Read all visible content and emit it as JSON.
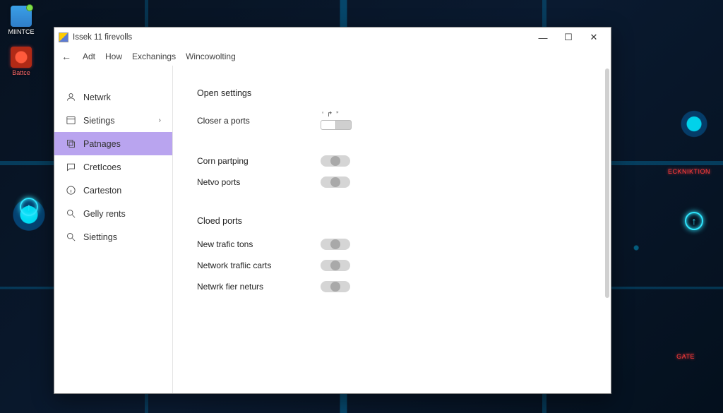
{
  "desktop": {
    "icon1_label": "MIINTCE",
    "icon2_label": "Battce"
  },
  "wallpaper_tags": {
    "tag1": "ECKNIKTION",
    "tag2": "GATE"
  },
  "window": {
    "title": "Issek 11 firevolls"
  },
  "menubar": {
    "item1": "Adt",
    "item2": "How",
    "item3": "Exchanings",
    "item4": "Wincowolting"
  },
  "sidebar": {
    "items": [
      {
        "label": "Netwrk"
      },
      {
        "label": "Sietings"
      },
      {
        "label": "Patnages"
      },
      {
        "label": "CretIcoes"
      },
      {
        "label": "Carteston"
      },
      {
        "label": "Gelly rents"
      },
      {
        "label": "Siettings"
      }
    ]
  },
  "content": {
    "section1_title": "Open settings",
    "closer_ports": "Closer a ports",
    "closer_mini": "‘ ↱ ”",
    "corn_partping": "Corn partping",
    "netvo_ports": "Netvo ports",
    "section2_title": "Cloed ports",
    "new_trafic": "New trafic tons",
    "network_carts": "Network traflic carts",
    "network_fier": "Netwrk fier neturs"
  }
}
